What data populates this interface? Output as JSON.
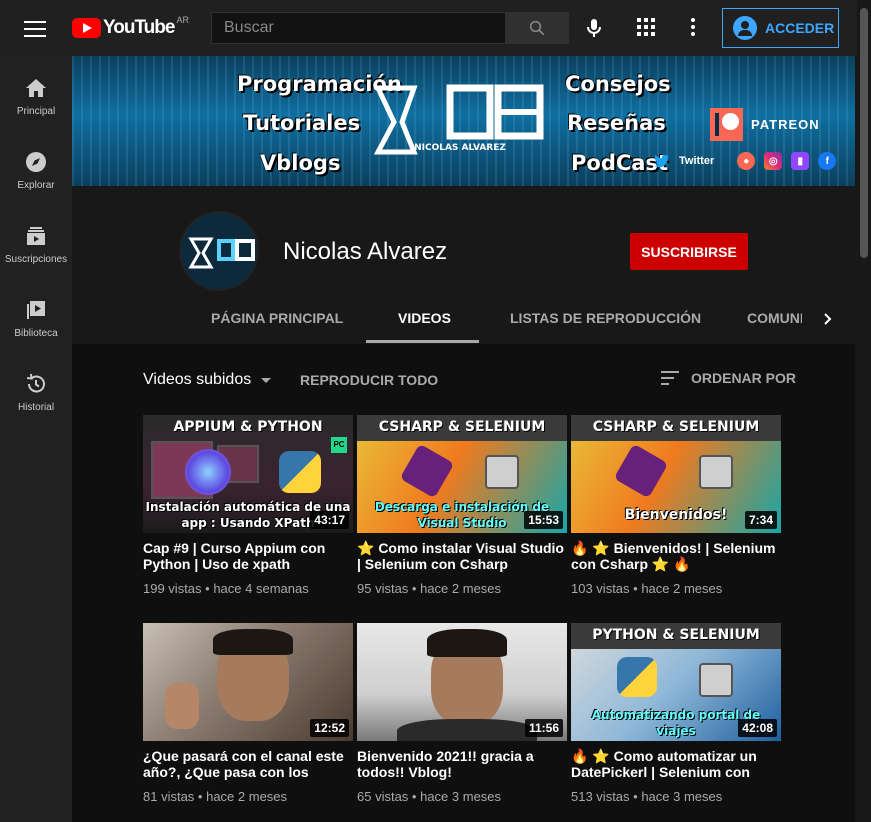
{
  "topbar": {
    "logo_text": "YouTube",
    "country_code": "AR",
    "search_placeholder": "Buscar",
    "signin_label": "ACCEDER"
  },
  "sidebar": {
    "items": [
      {
        "label": "Principal",
        "icon": "home-icon"
      },
      {
        "label": "Explorar",
        "icon": "compass-icon"
      },
      {
        "label": "Suscripciones",
        "icon": "subscriptions-icon"
      },
      {
        "label": "Biblioteca",
        "icon": "library-icon"
      },
      {
        "label": "Historial",
        "icon": "history-icon"
      }
    ]
  },
  "banner": {
    "left_lines": [
      "Programación",
      "Tutoriales",
      "Vblogs"
    ],
    "right_lines": [
      "Consejos",
      "Reseñas",
      "PodCast"
    ],
    "logo_caption": "NICOLAS ALVAREZ",
    "patreon_label": "PATREON",
    "twitter_label": "Twitter"
  },
  "channel": {
    "name": "Nicolas Alvarez",
    "subscribe_label": "SUSCRIBIRSE"
  },
  "tabs": [
    {
      "label": "PÁGINA PRINCIPAL"
    },
    {
      "label": "VIDEOS"
    },
    {
      "label": "LISTAS DE REPRODUCCIÓN"
    },
    {
      "label": "COMUNIDAD"
    }
  ],
  "videos_bar": {
    "section_label": "Videos subidos",
    "play_all_label": "REPRODUCIR TODO",
    "sort_label": "ORDENAR POR"
  },
  "videos": [
    {
      "title": "Cap #9 | Curso Appium con Python | Uso de xpath",
      "views": "199 vistas",
      "age": "hace 4 semanas",
      "duration": "43:17",
      "thumb_title": "APPIUM & PYTHON",
      "thumb_sub": "Instalación automática de una app : Usando XPath"
    },
    {
      "title": "⭐ Como instalar Visual Studio | Selenium con Csharp",
      "views": "95 vistas",
      "age": "hace 2 meses",
      "duration": "15:53",
      "thumb_title": "CSHARP & SELENIUM",
      "thumb_sub": "Descarga e instalación de Visual Studio"
    },
    {
      "title": "🔥 ⭐ Bienvenidos! | Selenium con Csharp ⭐ 🔥",
      "views": "103 vistas",
      "age": "hace 2 meses",
      "duration": "7:34",
      "thumb_title": "CSHARP & SELENIUM",
      "thumb_sub": "Bienvenidos!"
    },
    {
      "title": "¿Que pasará con el canal este año?, ¿Que pasa con los videos?",
      "views": "81 vistas",
      "age": "hace 2 meses",
      "duration": "12:52",
      "thumb_title": "",
      "thumb_sub": ""
    },
    {
      "title": "Bienvenido 2021!! gracia a todos!! Vblog!",
      "views": "65 vistas",
      "age": "hace 3 meses",
      "duration": "11:56",
      "thumb_title": "",
      "thumb_sub": ""
    },
    {
      "title": "🔥 ⭐ Como automatizar un DatePickerl | Selenium con Python",
      "views": "513 vistas",
      "age": "hace 3 meses",
      "duration": "42:08",
      "thumb_title": "PYTHON & SELENIUM",
      "thumb_sub": "Automatizando portal de viajes"
    }
  ],
  "colors": {
    "accent_blue": "#3ea6ff",
    "subscribe_red": "#cc0000",
    "youtube_red": "#ff0000"
  }
}
